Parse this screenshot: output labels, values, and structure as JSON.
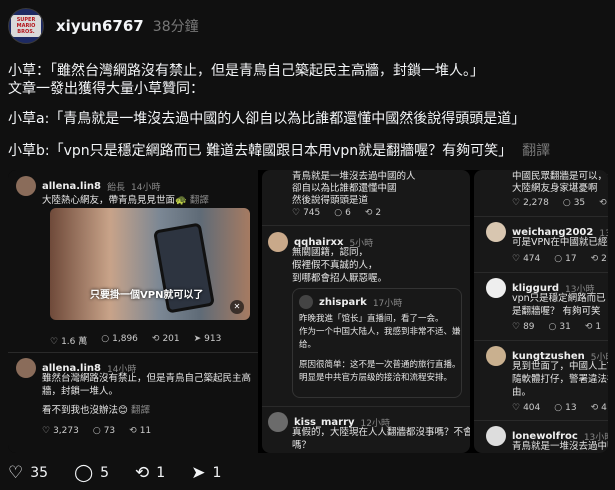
{
  "post": {
    "username": "xiyun6767",
    "time": "38分鐘",
    "lines": [
      "小草：「雖然台灣網路沒有禁止，但是青鳥自己築起民主高牆，封鎖一堆人。」",
      "文章一發出獲得大量小草贊同：",
      "小草a:「青鳥就是一堆沒去過中國的人卻自以為比誰都還懂中國然後說得頭頭是道」",
      "小草b:「vpn只是穩定網路而已 難道去韓國跟日本用vpn就是翻牆喔？有夠可笑」"
    ],
    "translate": "翻譯",
    "avatar_text": [
      "SUPER",
      "MARIO",
      "BROS."
    ]
  },
  "image": {
    "panel1": {
      "post1": {
        "name": "allena.lin8",
        "tag": "飴長",
        "time": "14小時",
        "text": "大陸熱心網友，帶青鳥見見世面🐢",
        "translate": "翻譯",
        "subtitle": "只要掛一個VPN就可以了",
        "actions": [
          "1.6 萬",
          "1,896",
          "201",
          "913"
        ]
      },
      "post2": {
        "name": "allena.lin8",
        "time": "14小時",
        "lines": [
          "雖然台灣網路沒有禁止，但是青鳥自己築起民主高",
          "牆，封鎖一堆人。",
          "看不到我也沒辦法😊"
        ],
        "translate": "翻譯",
        "actions": [
          "3,273",
          "73",
          "11"
        ]
      }
    },
    "panel2": {
      "top_lines": [
        "青鳥就是一堆沒去過中國的人",
        "卻自以為比誰都還懂中國",
        "然後說得頭頭是道"
      ],
      "top_actions": [
        "745",
        "6",
        "2"
      ],
      "post1": {
        "name": "qqhairxx",
        "time": "5小時",
        "lines": [
          "無關國籍，認同，",
          "假裡假不真誠的人，",
          "到哪都會招人厭惡喔。"
        ]
      },
      "quote": {
        "name": "zhispark",
        "time": "17小時",
        "lines": [
          "昨晚我進「馆长」直播间，看了一会。",
          "作为一个中国大陆人，我感到非常不适、嫌",
          "给。",
          "原因很简单：这不是一次普通的旅行直播。",
          "明显是中共官方层级的接洽和流程安排。"
        ]
      },
      "post2": {
        "name": "kiss_marry",
        "time": "12小時",
        "lines": [
          "真假的，大陸現在人人翻牆都沒事嗎？不會被檢舉",
          "嗎？"
        ]
      }
    },
    "panel3": {
      "top_lines": [
        "中國民眾翻牆是可以，但沒這麼",
        "大陸網友身家堪憂啊"
      ],
      "top_actions": [
        "2,278",
        "35",
        "7"
      ],
      "posts": [
        {
          "name": "weichang2002",
          "time": "13小時",
          "lines": [
            "可是VPN在中國就已經違法了欸"
          ],
          "actions": [
            "474",
            "17",
            "2"
          ]
        },
        {
          "name": "kliggurd",
          "time": "13小時",
          "lines": [
            "vpn只是穩定網路而已 難道去韓",
            "是翻牆喔？ 有夠可笑"
          ],
          "actions": [
            "89",
            "31",
            "1"
          ]
        },
        {
          "name": "kungtzushen",
          "time": "5小時",
          "lines": [
            "見到世面了，中國人上YouTube",
            "隨軟體打仔，警署違法被處罰的",
            "由。"
          ],
          "actions": [
            "404",
            "13",
            "4"
          ]
        },
        {
          "name": "lonewolfroc",
          "time": "13小時",
          "lines": [
            "青鳥就是一堆沒去過中國的"
          ],
          "actions": []
        }
      ]
    }
  },
  "actions": {
    "like": "35",
    "comment": "5",
    "repost": "1",
    "share": "1"
  },
  "colors": {
    "background": "#101010",
    "text": "#f3f5f7",
    "muted": "#777777"
  }
}
